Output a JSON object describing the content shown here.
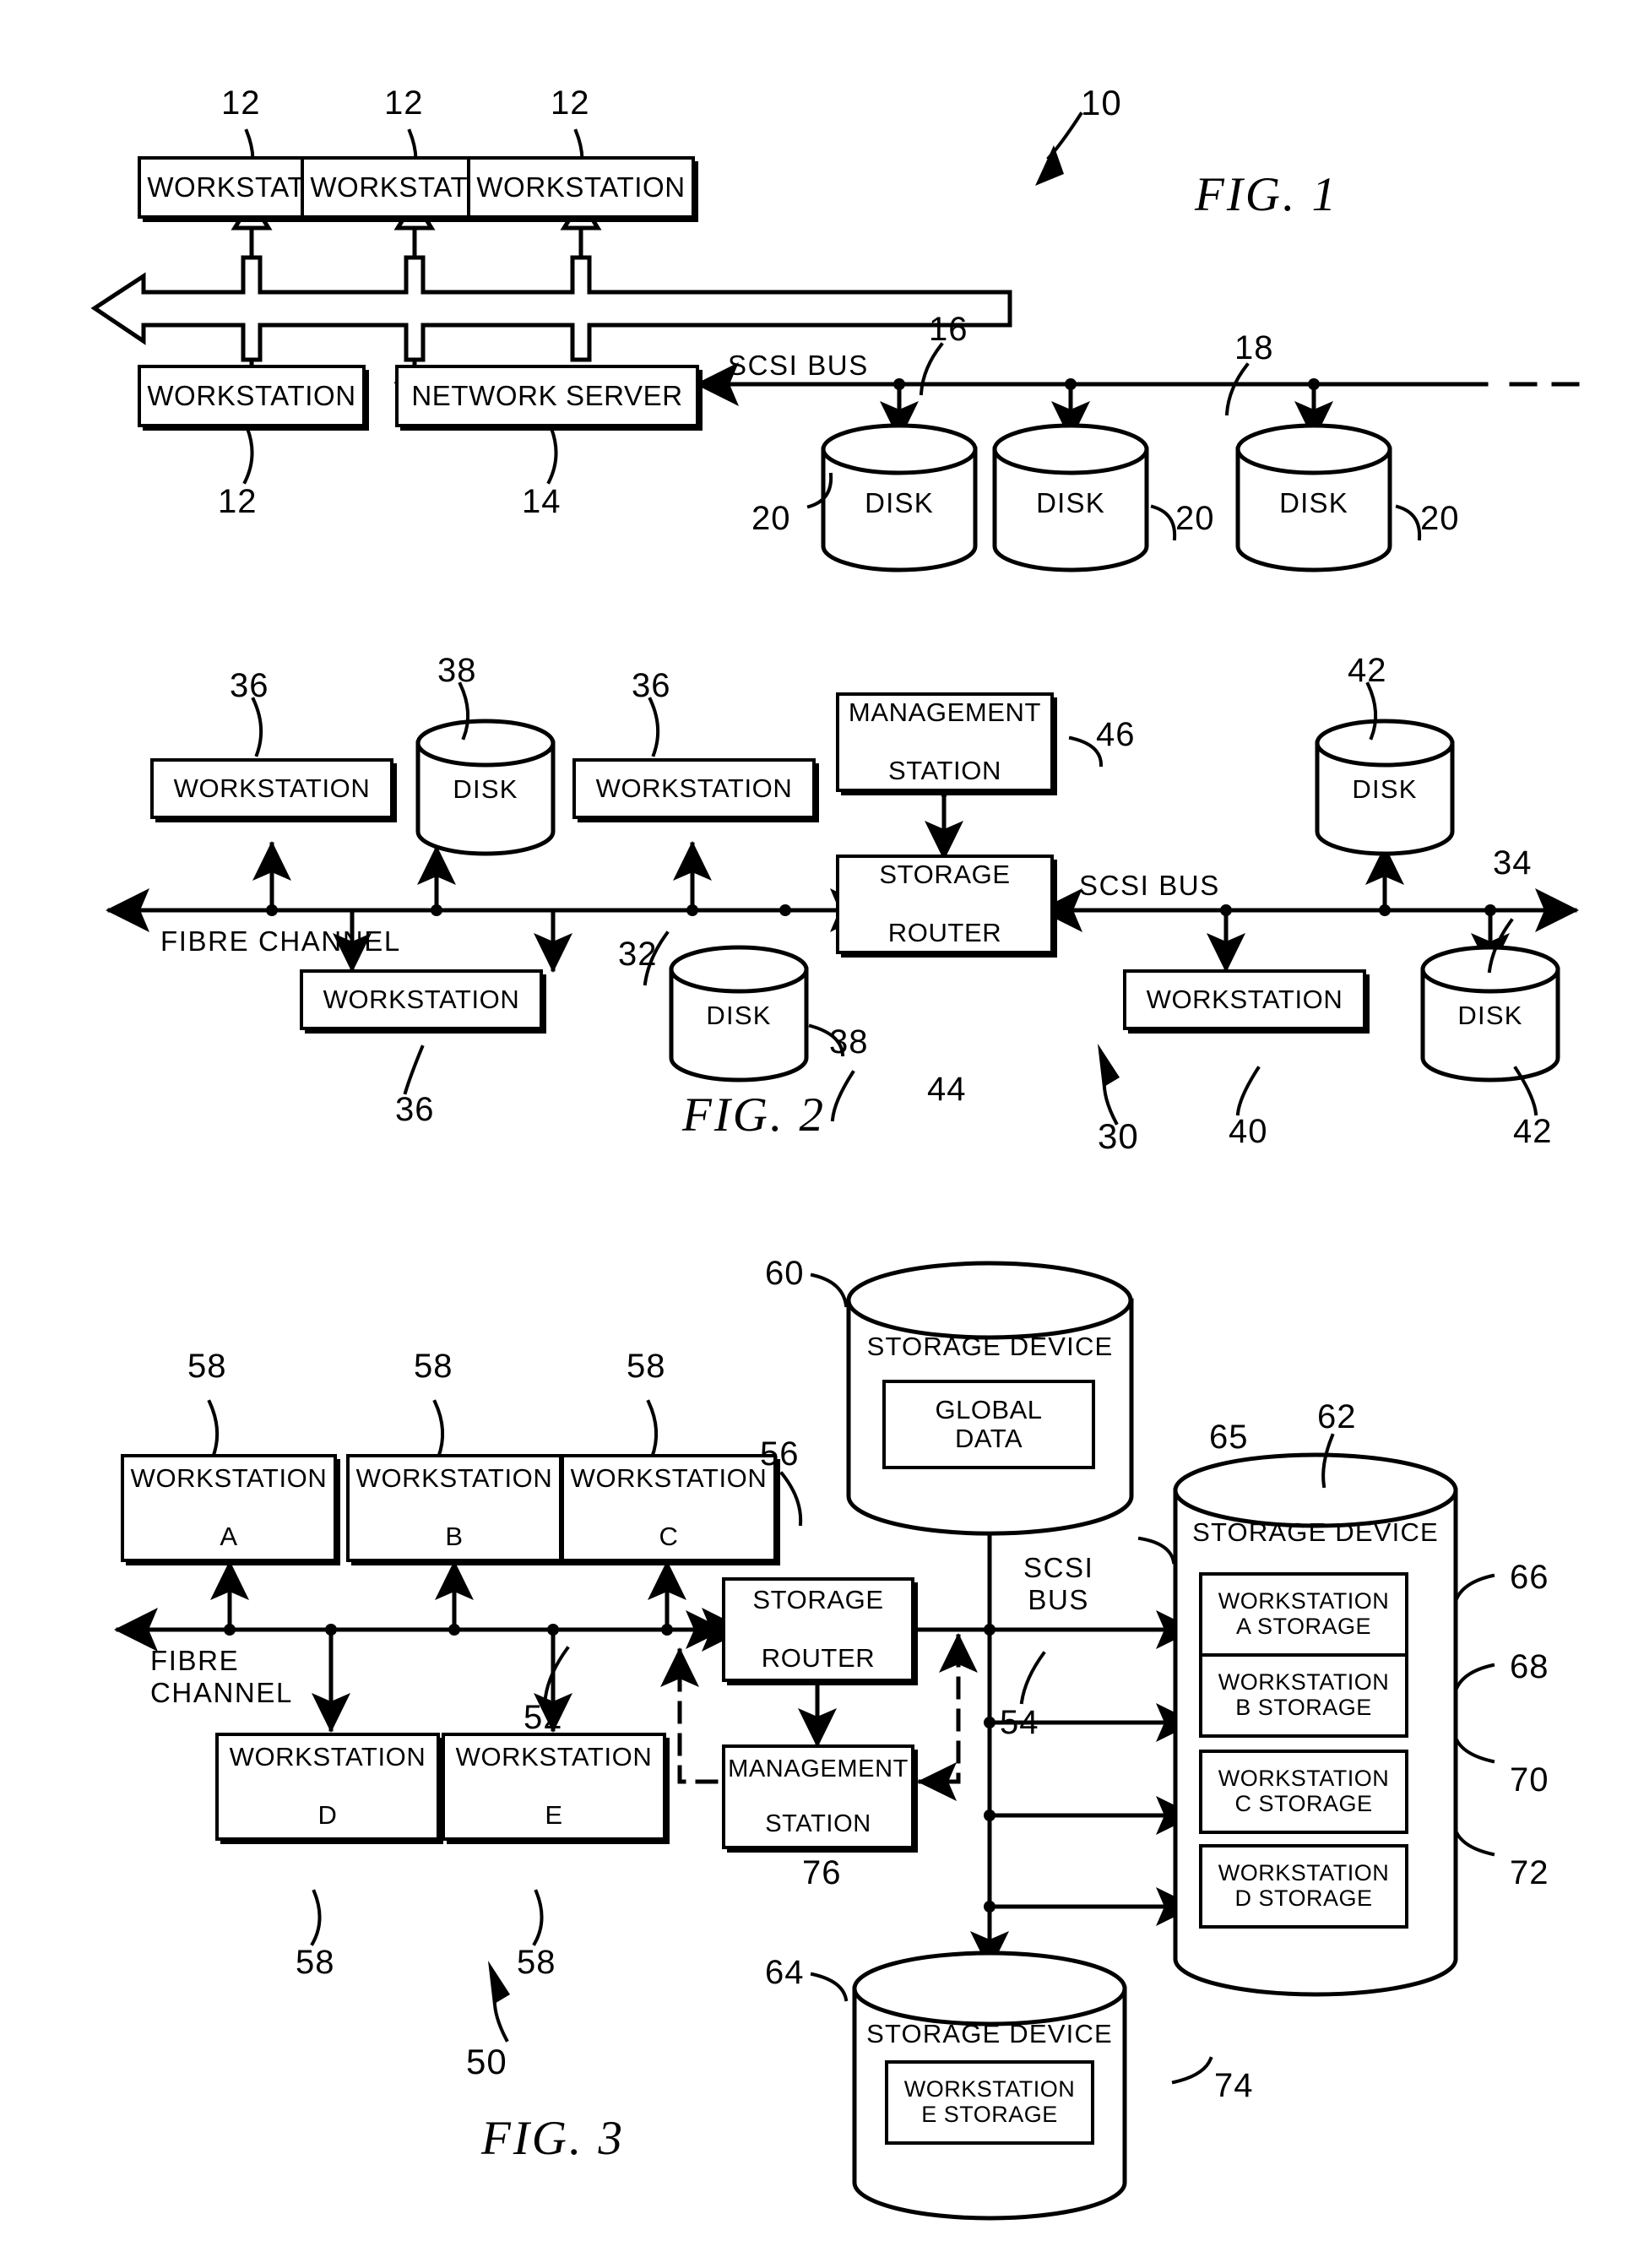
{
  "document": {
    "type": "patent-drawing-sheet",
    "figures": [
      {
        "caption": "FIG.  1",
        "ref": "10",
        "nodes": [
          {
            "id": "ws1",
            "label": "WORKSTATION",
            "ref": "12"
          },
          {
            "id": "ws2",
            "label": "WORKSTATION",
            "ref": "12"
          },
          {
            "id": "ws3",
            "label": "WORKSTATION",
            "ref": "12"
          },
          {
            "id": "ws4",
            "label": "WORKSTATION",
            "ref": "12"
          },
          {
            "id": "srv",
            "label": "NETWORK  SERVER",
            "ref": "14"
          },
          {
            "id": "d1",
            "label": "DISK",
            "ref": "20"
          },
          {
            "id": "d2",
            "label": "DISK",
            "ref": "20"
          },
          {
            "id": "d3",
            "label": "DISK",
            "ref": "20"
          }
        ],
        "bus_labels": [
          {
            "text": "SCSI BUS",
            "ref": "16"
          },
          {
            "text": "",
            "ref": "18"
          }
        ]
      },
      {
        "caption": "FIG.  2",
        "ref": "30",
        "nodes": [
          {
            "id": "ws1",
            "label": "WORKSTATION",
            "ref": "36"
          },
          {
            "id": "ws2",
            "label": "WORKSTATION",
            "ref": "36"
          },
          {
            "id": "ws3",
            "label": "WORKSTATION",
            "ref": "36"
          },
          {
            "id": "dk1",
            "label": "DISK",
            "ref": "38"
          },
          {
            "id": "dk2",
            "label": "DISK",
            "ref": "38"
          },
          {
            "id": "mgmt",
            "label": "MANAGEMENT\nSTATION",
            "ref": "46"
          },
          {
            "id": "router",
            "label": "STORAGE\nROUTER",
            "ref": "44"
          },
          {
            "id": "ws4",
            "label": "WORKSTATION",
            "ref": "40"
          },
          {
            "id": "dk3",
            "label": "DISK",
            "ref": "42"
          },
          {
            "id": "dk4",
            "label": "DISK",
            "ref": "42"
          }
        ],
        "bus_labels": [
          {
            "text": "FIBRE CHANNEL",
            "ref": "32"
          },
          {
            "text": "SCSI  BUS",
            "ref": "34"
          }
        ]
      },
      {
        "caption": "FIG.  3",
        "ref": "50",
        "nodes": [
          {
            "id": "wsa",
            "label": "WORKSTATION\nA",
            "ref": "58"
          },
          {
            "id": "wsb",
            "label": "WORKSTATION\nB",
            "ref": "58"
          },
          {
            "id": "wsc",
            "label": "WORKSTATION\nC",
            "ref": "58"
          },
          {
            "id": "wsd",
            "label": "WORKSTATION\nD",
            "ref": "58"
          },
          {
            "id": "wse",
            "label": "WORKSTATION\nE",
            "ref": "58"
          },
          {
            "id": "router",
            "label": "STORAGE\nROUTER",
            "ref": "56"
          },
          {
            "id": "mgmt",
            "label": "MANAGEMENT\nSTATION",
            "ref": "76"
          },
          {
            "id": "sd_top",
            "label": "STORAGE  DEVICE",
            "ref": "60"
          },
          {
            "id": "sd_right",
            "label": "STORAGE  DEVICE",
            "ref": "62"
          },
          {
            "id": "sd_bottom",
            "label": "STORAGE  DEVICE",
            "ref": "64"
          }
        ],
        "partitions": [
          {
            "label": "GLOBAL\nDATA",
            "ref": "65",
            "parent": "sd_top"
          },
          {
            "label": "WORKSTATION\nA STORAGE",
            "ref": "66",
            "parent": "sd_right"
          },
          {
            "label": "WORKSTATION\nB STORAGE",
            "ref": "68",
            "parent": "sd_right"
          },
          {
            "label": "WORKSTATION\nC STORAGE",
            "ref": "70",
            "parent": "sd_right"
          },
          {
            "label": "WORKSTATION\nD STORAGE",
            "ref": "72",
            "parent": "sd_right"
          },
          {
            "label": "WORKSTATION\nE STORAGE",
            "ref": "74",
            "parent": "sd_bottom"
          }
        ],
        "bus_labels": [
          {
            "text": "FIBRE\nCHANNEL",
            "ref": "52"
          },
          {
            "text": "SCSI\nBUS",
            "ref": "54"
          }
        ]
      }
    ]
  },
  "fig1": {
    "caption": "FIG.  1",
    "ref10": "10",
    "ws_top_1": "WORKSTATION",
    "ws_top_2": "WORKSTATION",
    "ws_top_3": "WORKSTATION",
    "ws_bottom": "WORKSTATION",
    "server": "NETWORK  SERVER",
    "disk1": "DISK",
    "disk2": "DISK",
    "disk3": "DISK",
    "scsi_bus": "SCSI BUS",
    "ref12a": "12",
    "ref12b": "12",
    "ref12c": "12",
    "ref12d": "12",
    "ref14": "14",
    "ref16": "16",
    "ref18": "18",
    "ref20a": "20",
    "ref20b": "20",
    "ref20c": "20"
  },
  "fig2": {
    "caption": "FIG.  2",
    "ref30": "30",
    "ws1": "WORKSTATION",
    "ws2": "WORKSTATION",
    "ws3": "WORKSTATION",
    "ws4": "WORKSTATION",
    "disk1": "DISK",
    "disk2": "DISK",
    "disk3": "DISK",
    "disk4": "DISK",
    "mgmt_l1": "MANAGEMENT",
    "mgmt_l2": "STATION",
    "router_l1": "STORAGE",
    "router_l2": "ROUTER",
    "fibre_channel": "FIBRE  CHANNEL",
    "scsi_bus": "SCSI  BUS",
    "ref36a": "36",
    "ref36b": "36",
    "ref36c": "36",
    "ref38a": "38",
    "ref38b": "38",
    "ref40": "40",
    "ref42a": "42",
    "ref42b": "42",
    "ref44": "44",
    "ref46": "46",
    "ref32": "32",
    "ref34": "34"
  },
  "fig3": {
    "caption": "FIG.  3",
    "ref50": "50",
    "wsa_l1": "WORKSTATION",
    "wsa_l2": "A",
    "wsb_l1": "WORKSTATION",
    "wsb_l2": "B",
    "wsc_l1": "WORKSTATION",
    "wsc_l2": "C",
    "wsd_l1": "WORKSTATION",
    "wsd_l2": "D",
    "wse_l1": "WORKSTATION",
    "wse_l2": "E",
    "router_l1": "STORAGE",
    "router_l2": "ROUTER",
    "mgmt_l1": "MANAGEMENT",
    "mgmt_l2": "STATION",
    "sd_top": "STORAGE  DEVICE",
    "sd_right": "STORAGE  DEVICE",
    "sd_bottom": "STORAGE  DEVICE",
    "global_l1": "GLOBAL",
    "global_l2": "DATA",
    "pa_l1": "WORKSTATION",
    "pa_l2": "A STORAGE",
    "pb_l1": "WORKSTATION",
    "pb_l2": "B STORAGE",
    "pc_l1": "WORKSTATION",
    "pc_l2": "C STORAGE",
    "pd_l1": "WORKSTATION",
    "pd_l2": "D STORAGE",
    "pe_l1": "WORKSTATION",
    "pe_l2": "E STORAGE",
    "fibre_l1": "FIBRE",
    "fibre_l2": "CHANNEL",
    "scsi_l1": "SCSI",
    "scsi_l2": "BUS",
    "ref58a": "58",
    "ref58b": "58",
    "ref58c": "58",
    "ref58d": "58",
    "ref58e": "58",
    "ref52": "52",
    "ref54": "54",
    "ref56": "56",
    "ref60": "60",
    "ref62": "62",
    "ref64": "64",
    "ref65": "65",
    "ref66": "66",
    "ref68": "68",
    "ref70": "70",
    "ref72": "72",
    "ref74": "74",
    "ref76": "76"
  },
  "colors": {
    "ink": "#000000",
    "paper": "#ffffff"
  }
}
